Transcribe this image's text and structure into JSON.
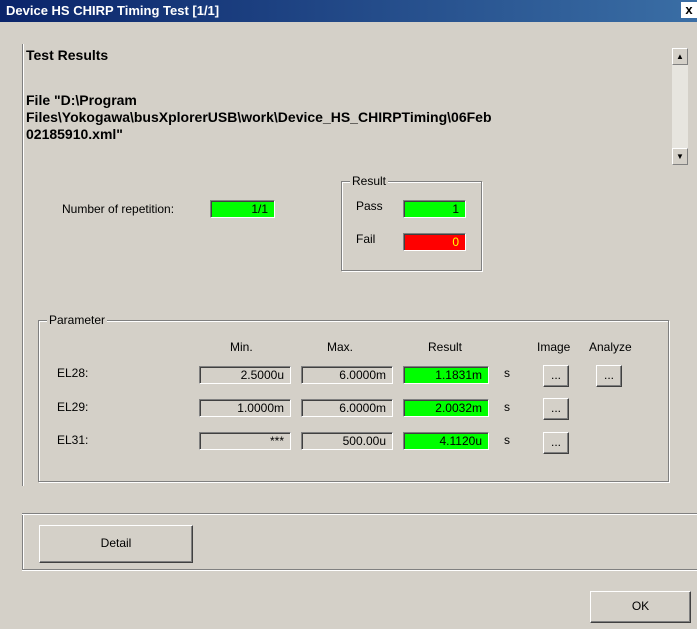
{
  "window": {
    "title": "Device HS CHIRP Timing Test [1/1]",
    "close_glyph": "x"
  },
  "results": {
    "heading": "Test Results",
    "file_line1": "File \"D:\\Program",
    "file_line2": "Files\\Yokogawa\\busXplorerUSB\\work\\Device_HS_CHIRPTiming\\06Feb",
    "file_line3": "02185910.xml\""
  },
  "repetition": {
    "label": "Number of repetition:",
    "value": "1/1"
  },
  "result_group": {
    "legend": "Result",
    "pass_label": "Pass",
    "pass_value": "1",
    "fail_label": "Fail",
    "fail_value": "0"
  },
  "parameter_group": {
    "legend": "Parameter",
    "headers": {
      "min": "Min.",
      "max": "Max.",
      "result": "Result",
      "image": "Image",
      "analyze": "Analyze"
    },
    "rows": [
      {
        "name": "EL28:",
        "min": "2.5000u",
        "max": "6.0000m",
        "result": "1.1831m",
        "unit": "s",
        "image_btn": "...",
        "analyze_btn": "..."
      },
      {
        "name": "EL29:",
        "min": "1.0000m",
        "max": "6.0000m",
        "result": "2.0032m",
        "unit": "s",
        "image_btn": "..."
      },
      {
        "name": "EL31:",
        "min": "***",
        "max": "500.00u",
        "result": "4.1120u",
        "unit": "s",
        "image_btn": "..."
      }
    ]
  },
  "buttons": {
    "detail": "Detail",
    "ok": "OK"
  },
  "colors": {
    "pass": "#00ff00",
    "fail": "#ff0000",
    "titlebar": "#0a246a"
  }
}
